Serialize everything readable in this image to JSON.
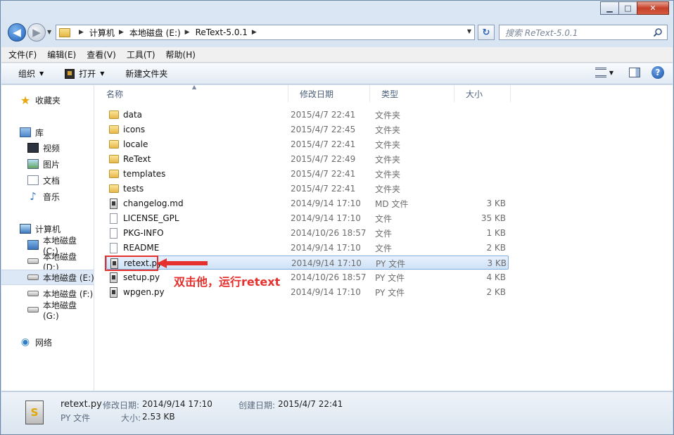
{
  "caption": {
    "minimize": "▁",
    "maximize": "□",
    "close": "✕"
  },
  "address": {
    "crumbs": [
      "计算机",
      "本地磁盘 (E:)",
      "ReText-5.0.1"
    ],
    "search_placeholder": "搜索 ReText-5.0.1"
  },
  "menu": [
    "文件(F)",
    "编辑(E)",
    "查看(V)",
    "工具(T)",
    "帮助(H)"
  ],
  "commands": {
    "organize": "组织",
    "open": "打开",
    "new_folder": "新建文件夹"
  },
  "nav": {
    "favorites": "收藏夹",
    "libraries": "库",
    "videos": "视频",
    "pictures": "图片",
    "documents": "文档",
    "music": "音乐",
    "computer": "计算机",
    "drive_c": "本地磁盘 (C:)",
    "drive_d": "本地磁盘 (D:)",
    "drive_e": "本地磁盘 (E:)",
    "drive_f": "本地磁盘 (F:)",
    "drive_g": "本地磁盘 (G:)",
    "network": "网络"
  },
  "columns": {
    "name": "名称",
    "date": "修改日期",
    "type": "类型",
    "size": "大小"
  },
  "files": [
    {
      "name": "data",
      "date": "2015/4/7 22:41",
      "type": "文件夹",
      "size": "",
      "kind": "folder"
    },
    {
      "name": "icons",
      "date": "2015/4/7 22:45",
      "type": "文件夹",
      "size": "",
      "kind": "folder"
    },
    {
      "name": "locale",
      "date": "2015/4/7 22:41",
      "type": "文件夹",
      "size": "",
      "kind": "folder"
    },
    {
      "name": "ReText",
      "date": "2015/4/7 22:49",
      "type": "文件夹",
      "size": "",
      "kind": "folder"
    },
    {
      "name": "templates",
      "date": "2015/4/7 22:41",
      "type": "文件夹",
      "size": "",
      "kind": "folder"
    },
    {
      "name": "tests",
      "date": "2015/4/7 22:41",
      "type": "文件夹",
      "size": "",
      "kind": "folder"
    },
    {
      "name": "changelog.md",
      "date": "2014/9/14 17:10",
      "type": "MD 文件",
      "size": "3 KB",
      "kind": "py"
    },
    {
      "name": "LICENSE_GPL",
      "date": "2014/9/14 17:10",
      "type": "文件",
      "size": "35 KB",
      "kind": "file"
    },
    {
      "name": "PKG-INFO",
      "date": "2014/10/26 18:57",
      "type": "文件",
      "size": "1 KB",
      "kind": "file"
    },
    {
      "name": "README",
      "date": "2014/9/14 17:10",
      "type": "文件",
      "size": "2 KB",
      "kind": "file"
    },
    {
      "name": "retext.py",
      "date": "2014/9/14 17:10",
      "type": "PY 文件",
      "size": "3 KB",
      "kind": "py"
    },
    {
      "name": "setup.py",
      "date": "2014/10/26 18:57",
      "type": "PY 文件",
      "size": "4 KB",
      "kind": "py"
    },
    {
      "name": "wpgen.py",
      "date": "2014/9/14 17:10",
      "type": "PY 文件",
      "size": "2 KB",
      "kind": "py"
    }
  ],
  "selected_index": 10,
  "annotation": "双击他，运行retext",
  "details": {
    "name": "retext.py",
    "modified_label": "修改日期:",
    "modified_value": "2014/9/14 17:10",
    "created_label": "创建日期:",
    "created_value": "2015/4/7 22:41",
    "type": "PY 文件",
    "size_label": "大小:",
    "size_value": "2.53 KB"
  },
  "colors": {
    "annotation": "#e5302d",
    "selection": "#cee2f8"
  }
}
